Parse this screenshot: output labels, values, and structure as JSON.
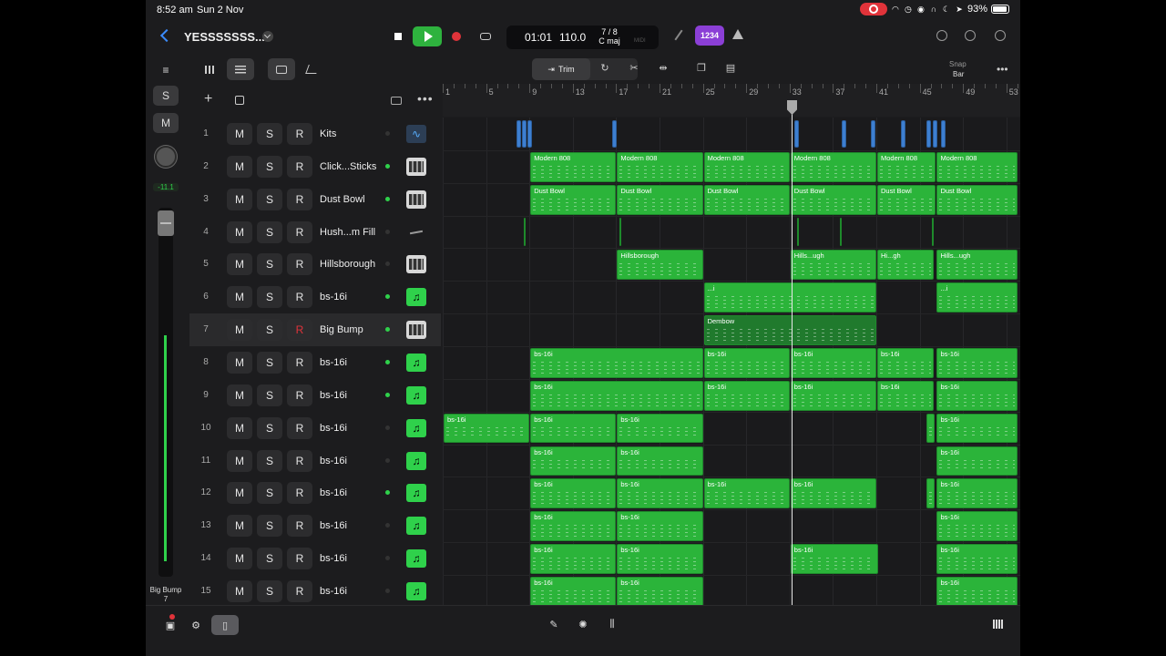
{
  "status": {
    "time": "8:52 am",
    "date": "Sun 2 Nov",
    "battery": "93%",
    "battery_level": 0.93
  },
  "project": {
    "title": "YESSSSSSS..."
  },
  "transport": {
    "position": "01:01",
    "tempo": "110.0",
    "signature": "7 / 8",
    "key": "C maj",
    "count_in": "1234",
    "midi_label": "MIDI"
  },
  "timeline_tools": {
    "trim_label": "Trim",
    "snap_label": "Snap",
    "snap_value": "Bar"
  },
  "inspector": {
    "solo": "S",
    "mute": "M",
    "volume": "-11.1",
    "track_name": "Big Bump",
    "track_number": "7",
    "meter_level": 0.62
  },
  "track_buttons": {
    "mute": "M",
    "solo": "S",
    "record": "R"
  },
  "tracks": [
    {
      "num": "1",
      "name": "Kits",
      "icon": "waveform-icon",
      "active": false,
      "armed": false
    },
    {
      "num": "2",
      "name": "Click...Sticks",
      "icon": "drum-machine-icon",
      "active": true,
      "armed": false
    },
    {
      "num": "3",
      "name": "Dust Bowl",
      "icon": "drum-machine-icon",
      "active": true,
      "armed": false
    },
    {
      "num": "4",
      "name": "Hush...m Fill",
      "icon": "drumstick-icon",
      "active": false,
      "armed": false
    },
    {
      "num": "5",
      "name": "Hillsborough",
      "icon": "drum-machine-icon",
      "active": false,
      "armed": false
    },
    {
      "num": "6",
      "name": "bs-16i",
      "icon": "synth-icon",
      "active": true,
      "armed": false
    },
    {
      "num": "7",
      "name": "Big Bump",
      "icon": "drum-machine-icon",
      "active": true,
      "armed": true
    },
    {
      "num": "8",
      "name": "bs-16i",
      "icon": "synth-icon",
      "active": true,
      "armed": false
    },
    {
      "num": "9",
      "name": "bs-16i",
      "icon": "synth-icon",
      "active": true,
      "armed": false
    },
    {
      "num": "10",
      "name": "bs-16i",
      "icon": "synth-icon",
      "active": false,
      "armed": false
    },
    {
      "num": "11",
      "name": "bs-16i",
      "icon": "synth-icon",
      "active": false,
      "armed": false
    },
    {
      "num": "12",
      "name": "bs-16i",
      "icon": "synth-icon",
      "active": true,
      "armed": false
    },
    {
      "num": "13",
      "name": "bs-16i",
      "icon": "synth-icon",
      "active": false,
      "armed": false
    },
    {
      "num": "14",
      "name": "bs-16i",
      "icon": "synth-icon",
      "active": false,
      "armed": false
    },
    {
      "num": "15",
      "name": "bs-16i",
      "icon": "synth-icon",
      "active": false,
      "armed": false
    }
  ],
  "ruler": {
    "bars": [
      "1",
      "5",
      "9",
      "13",
      "17",
      "21",
      "25",
      "29",
      "33",
      "37",
      "41",
      "45",
      "49",
      "53"
    ],
    "playhead_bar": 33
  },
  "regions": [
    {
      "track": 2,
      "start": 9,
      "end": 17,
      "name": "Modern 808"
    },
    {
      "track": 2,
      "start": 17,
      "end": 25,
      "name": "Modern 808"
    },
    {
      "track": 2,
      "start": 25,
      "end": 33,
      "name": "Modern 808"
    },
    {
      "track": 2,
      "start": 33,
      "end": 41,
      "name": "Modern 808"
    },
    {
      "track": 2,
      "start": 41,
      "end": 46.5,
      "name": "Modern 808"
    },
    {
      "track": 2,
      "start": 46.5,
      "end": 54,
      "name": "Modern 808"
    },
    {
      "track": 3,
      "start": 9,
      "end": 17,
      "name": "Dust Bowl"
    },
    {
      "track": 3,
      "start": 17,
      "end": 25,
      "name": "Dust Bowl"
    },
    {
      "track": 3,
      "start": 25,
      "end": 33,
      "name": "Dust Bowl"
    },
    {
      "track": 3,
      "start": 33,
      "end": 41,
      "name": "Dust Bowl"
    },
    {
      "track": 3,
      "start": 41,
      "end": 46.5,
      "name": "Dust Bowl"
    },
    {
      "track": 3,
      "start": 46.5,
      "end": 54,
      "name": "Dust Bowl"
    },
    {
      "track": 5,
      "start": 17,
      "end": 25,
      "name": "Hillsborough"
    },
    {
      "track": 5,
      "start": 33,
      "end": 41,
      "name": "Hills...ugh"
    },
    {
      "track": 5,
      "start": 41,
      "end": 46.3,
      "name": "Hi...gh"
    },
    {
      "track": 5,
      "start": 46.5,
      "end": 54,
      "name": "Hills...ugh"
    },
    {
      "track": 6,
      "start": 25,
      "end": 41,
      "name": "...i"
    },
    {
      "track": 6,
      "start": 46.5,
      "end": 54,
      "name": "...i"
    },
    {
      "track": 7,
      "start": 25,
      "end": 41,
      "name": "Dembow",
      "dim": true
    },
    {
      "track": 8,
      "start": 9,
      "end": 25,
      "name": "bs-16i"
    },
    {
      "track": 8,
      "start": 25,
      "end": 33,
      "name": "bs-16i"
    },
    {
      "track": 8,
      "start": 33,
      "end": 41,
      "name": "bs-16i"
    },
    {
      "track": 8,
      "start": 41,
      "end": 46.3,
      "name": "bs-16i"
    },
    {
      "track": 8,
      "start": 46.5,
      "end": 54,
      "name": "bs-16i"
    },
    {
      "track": 9,
      "start": 9,
      "end": 25,
      "name": "bs-16i"
    },
    {
      "track": 9,
      "start": 25,
      "end": 33,
      "name": "bs-16i"
    },
    {
      "track": 9,
      "start": 33,
      "end": 41,
      "name": "bs-16i"
    },
    {
      "track": 9,
      "start": 41,
      "end": 46.3,
      "name": "bs-16i"
    },
    {
      "track": 9,
      "start": 46.5,
      "end": 54,
      "name": "bs-16i"
    },
    {
      "track": 10,
      "start": 1,
      "end": 9,
      "name": "bs-16i"
    },
    {
      "track": 10,
      "start": 9,
      "end": 17,
      "name": "bs-16i"
    },
    {
      "track": 10,
      "start": 17,
      "end": 25,
      "name": "bs-16i"
    },
    {
      "track": 10,
      "start": 45.5,
      "end": 46.4,
      "name": ""
    },
    {
      "track": 10,
      "start": 46.5,
      "end": 54,
      "name": "bs-16i"
    },
    {
      "track": 11,
      "start": 9,
      "end": 17,
      "name": "bs-16i"
    },
    {
      "track": 11,
      "start": 17,
      "end": 25,
      "name": "bs-16i"
    },
    {
      "track": 11,
      "start": 46.5,
      "end": 54,
      "name": "bs-16i"
    },
    {
      "track": 12,
      "start": 9,
      "end": 17,
      "name": "bs-16i"
    },
    {
      "track": 12,
      "start": 17,
      "end": 25,
      "name": "bs-16i"
    },
    {
      "track": 12,
      "start": 25,
      "end": 33,
      "name": "bs-16i"
    },
    {
      "track": 12,
      "start": 33,
      "end": 41,
      "name": "bs-16i"
    },
    {
      "track": 12,
      "start": 45.5,
      "end": 46.4,
      "name": ""
    },
    {
      "track": 12,
      "start": 46.5,
      "end": 54,
      "name": "bs-16i"
    },
    {
      "track": 13,
      "start": 9,
      "end": 17,
      "name": "bs-16i"
    },
    {
      "track": 13,
      "start": 17,
      "end": 25,
      "name": "bs-16i"
    },
    {
      "track": 13,
      "start": 46.5,
      "end": 54,
      "name": "bs-16i"
    },
    {
      "track": 14,
      "start": 9,
      "end": 17,
      "name": "bs-16i"
    },
    {
      "track": 14,
      "start": 17,
      "end": 25,
      "name": "bs-16i"
    },
    {
      "track": 14,
      "start": 33,
      "end": 41.2,
      "name": "bs-16i"
    },
    {
      "track": 14,
      "start": 46.5,
      "end": 54,
      "name": "bs-16i"
    },
    {
      "track": 15,
      "start": 9,
      "end": 17,
      "name": "bs-16i"
    },
    {
      "track": 15,
      "start": 17,
      "end": 25,
      "name": "bs-16i"
    },
    {
      "track": 15,
      "start": 46.5,
      "end": 54,
      "name": "bs-16i"
    }
  ],
  "kit_hits": [
    7.8,
    8.3,
    8.8,
    16.6,
    33.4,
    37.8,
    40.5,
    43.3,
    45.6,
    46.2,
    47.0
  ],
  "fill_hits": [
    8.5,
    17.3,
    33.7,
    37.6,
    46.1
  ],
  "colors": {
    "region_green": "#2bb43a",
    "accent_blue": "#3b8cff",
    "record_red": "#e0333a",
    "count_in_purple": "#8b3fd6"
  }
}
